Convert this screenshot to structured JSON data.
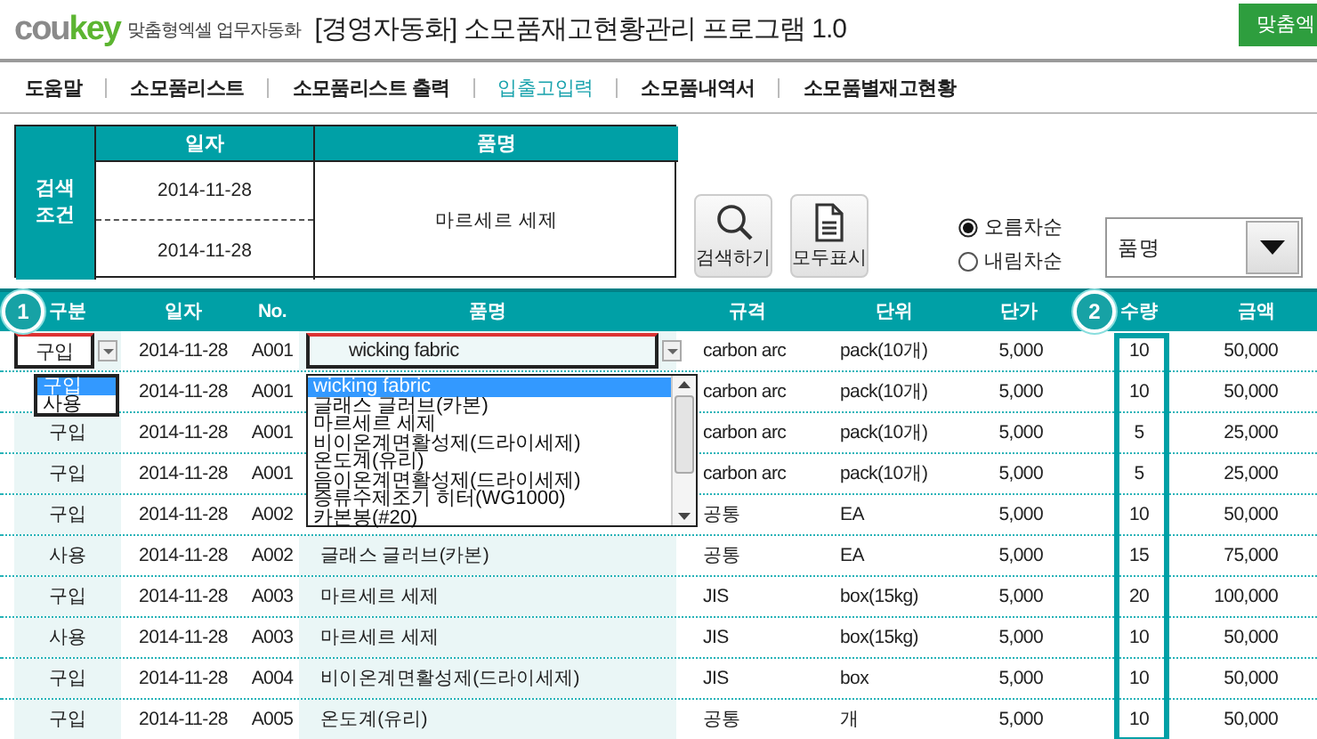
{
  "header": {
    "logo_prefix": "cou",
    "logo_suffix": "key",
    "tagline": "맞춤형엑셀 업무자동화",
    "title": "[경영자동화] 소모품재고현황관리 프로그램 1.0",
    "corner_button": "맞춤엑"
  },
  "nav": [
    {
      "label": "도움말",
      "selected": false
    },
    {
      "label": "소모품리스트",
      "selected": false
    },
    {
      "label": "소모품리스트 출력",
      "selected": false
    },
    {
      "label": "입출고입력",
      "selected": true
    },
    {
      "label": "소모품내역서",
      "selected": false
    },
    {
      "label": "소모품별재고현황",
      "selected": false
    }
  ],
  "search": {
    "label": "검색 조건",
    "date_header": "일자",
    "item_header": "품명",
    "date_from": "2014-11-28",
    "date_to": "2014-11-28",
    "item": "마르세르 세제"
  },
  "buttons": [
    {
      "kind": "search",
      "label": "검색하기"
    },
    {
      "kind": "document",
      "label": "모두표시"
    }
  ],
  "sort": [
    {
      "label": "오름차순",
      "selected": true
    },
    {
      "label": "내림차순",
      "selected": false
    }
  ],
  "sort_field": {
    "value": "품명"
  },
  "table": {
    "columns": [
      "구분",
      "일자",
      "No.",
      "품명",
      "규격",
      "단위",
      "단가",
      "수량",
      "금액"
    ],
    "rows": [
      {
        "kind": "edit",
        "cells": [
          "구입",
          "2014-11-28",
          "A001",
          "wicking fabric",
          "carbon arc",
          "pack(10개)",
          "5,000",
          "10",
          "50,000"
        ]
      },
      {
        "kind": "plain",
        "cells": [
          null,
          "2014-11-28",
          "A001",
          null,
          "carbon arc",
          "pack(10개)",
          "5,000",
          "10",
          "50,000"
        ]
      },
      {
        "kind": "plain",
        "cells": [
          "구입",
          "2014-11-28",
          "A001",
          null,
          "carbon arc",
          "pack(10개)",
          "5,000",
          "5",
          "25,000"
        ]
      },
      {
        "kind": "plain",
        "cells": [
          "구입",
          "2014-11-28",
          "A001",
          null,
          "carbon arc",
          "pack(10개)",
          "5,000",
          "5",
          "25,000"
        ]
      },
      {
        "kind": "plain",
        "cells": [
          "구입",
          "2014-11-28",
          "A002",
          null,
          "공통",
          "EA",
          "5,000",
          "10",
          "50,000"
        ]
      },
      {
        "kind": "plain",
        "cells": [
          "사용",
          "2014-11-28",
          "A002",
          "글래스 글러브(카본)",
          "공통",
          "EA",
          "5,000",
          "15",
          "75,000"
        ]
      },
      {
        "kind": "plain",
        "cells": [
          "구입",
          "2014-11-28",
          "A003",
          "마르세르 세제",
          "JIS",
          "box(15kg)",
          "5,000",
          "20",
          "100,000"
        ]
      },
      {
        "kind": "plain",
        "cells": [
          "사용",
          "2014-11-28",
          "A003",
          "마르세르 세제",
          "JIS",
          "box(15kg)",
          "5,000",
          "10",
          "50,000"
        ]
      },
      {
        "kind": "plain",
        "cells": [
          "구입",
          "2014-11-28",
          "A004",
          "비이온계면활성제(드라이세제)",
          "JIS",
          "box",
          "5,000",
          "10",
          "50,000"
        ]
      },
      {
        "kind": "plain",
        "cells": [
          "구입",
          "2014-11-28",
          "A005",
          "온도계(유리)",
          "공통",
          "개",
          "5,000",
          "10",
          "50,000"
        ]
      }
    ]
  },
  "type_dropdown": {
    "options": [
      {
        "label": "구입",
        "selected": true
      },
      {
        "label": "사용",
        "selected": false
      }
    ]
  },
  "item_dropdown": {
    "options": [
      {
        "label": "wicking fabric",
        "selected": true
      },
      {
        "label": "글래스 글러브(카본)",
        "selected": false
      },
      {
        "label": "마르세르 세제",
        "selected": false
      },
      {
        "label": "비이온계면활성제(드라이세제)",
        "selected": false
      },
      {
        "label": "온도계(유리)",
        "selected": false
      },
      {
        "label": "음이온계면활성제(드라이세제)",
        "selected": false
      },
      {
        "label": "증류수제조기 히터(WG1000)",
        "selected": false
      },
      {
        "label": "카본봉(#20)",
        "selected": false
      }
    ]
  },
  "callouts": [
    {
      "label": "1"
    },
    {
      "label": "2"
    }
  ]
}
